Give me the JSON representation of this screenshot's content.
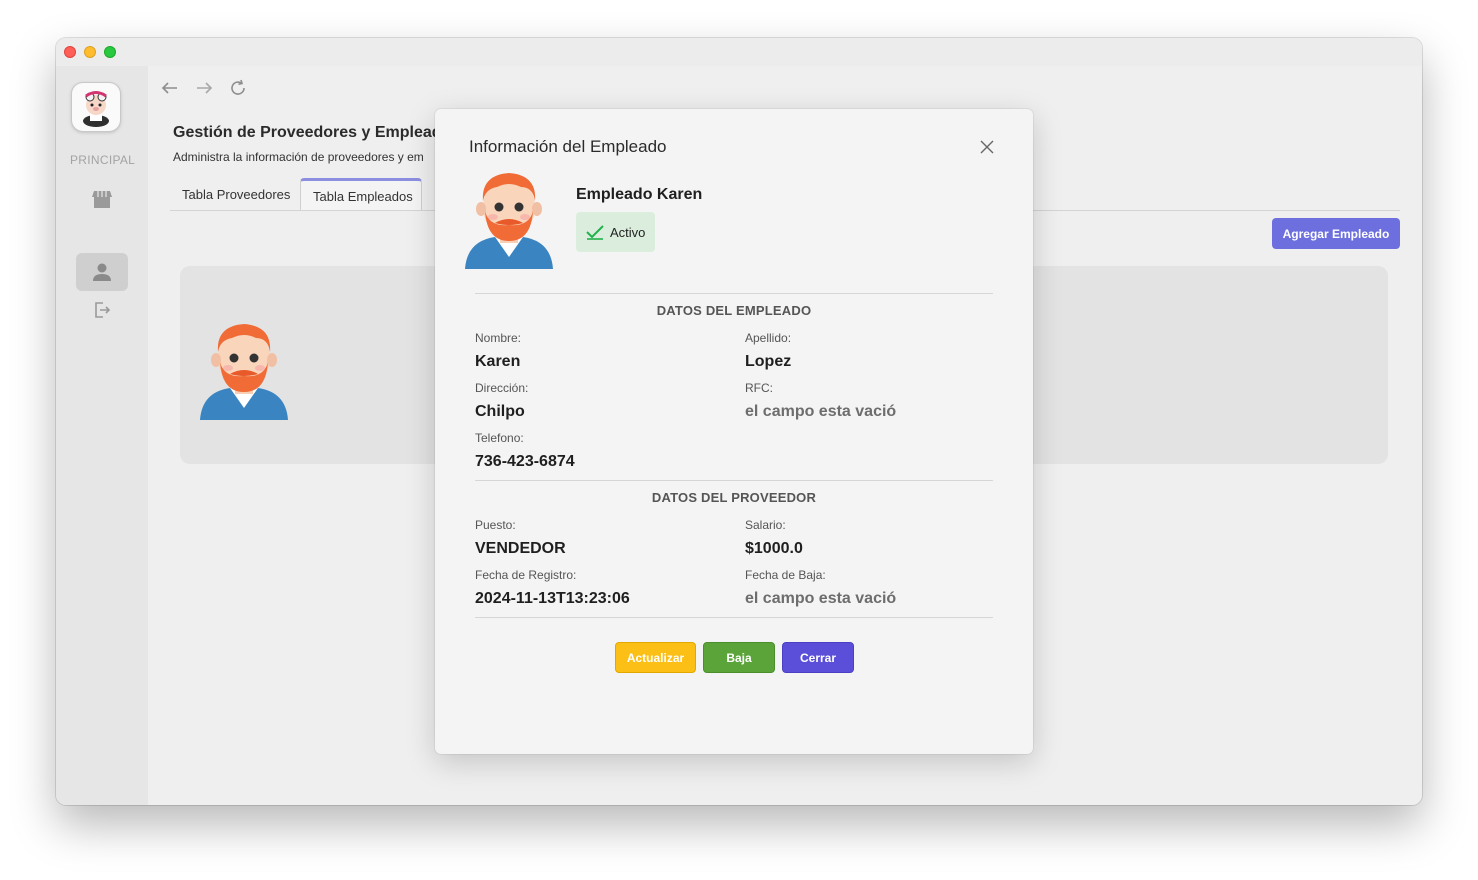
{
  "sidebar": {
    "section_label": "PRINCIPAL",
    "items": [
      {
        "icon": "store-icon"
      },
      {
        "icon": "user-icon",
        "active": true
      },
      {
        "icon": "logout-icon"
      }
    ]
  },
  "page": {
    "title": "Gestión de Proveedores y Empleados",
    "subtitle": "Administra la información de proveedores y em",
    "tabs": [
      {
        "label": "Tabla Proveedores"
      },
      {
        "label": "Tabla Empleados",
        "active": true
      }
    ],
    "add_button": "Agregar Empleado"
  },
  "modal": {
    "title": "Información del Empleado",
    "name": "Empleado Karen",
    "status": "Activo",
    "section_employee": "DATOS DEL EMPLEADO",
    "fields_employee": {
      "nombre_label": "Nombre:",
      "nombre": "Karen",
      "apellido_label": "Apellido:",
      "apellido": "Lopez",
      "direccion_label": "Dirección:",
      "direccion": "Chilpo",
      "rfc_label": "RFC:",
      "rfc": "el campo esta vació",
      "telefono_label": "Telefono:",
      "telefono": "736-423-6874"
    },
    "section_provider": "DATOS DEL PROVEEDOR",
    "fields_provider": {
      "puesto_label": "Puesto:",
      "puesto": "VENDEDOR",
      "salario_label": "Salario:",
      "salario": "$1000.0",
      "registro_label": "Fecha de Registro:",
      "registro": "2024-11-13T13:23:06",
      "baja_label": "Fecha de Baja:",
      "baja": "el campo esta vació"
    },
    "buttons": {
      "update": "Actualizar",
      "deactivate": "Baja",
      "close": "Cerrar"
    }
  },
  "colors": {
    "accent": "#6c6fdd",
    "update": "#fbbf15",
    "deactivate": "#5ba43a",
    "close": "#5b4fd9",
    "status_bg": "#dbeedd",
    "status_check": "#22b14c"
  }
}
